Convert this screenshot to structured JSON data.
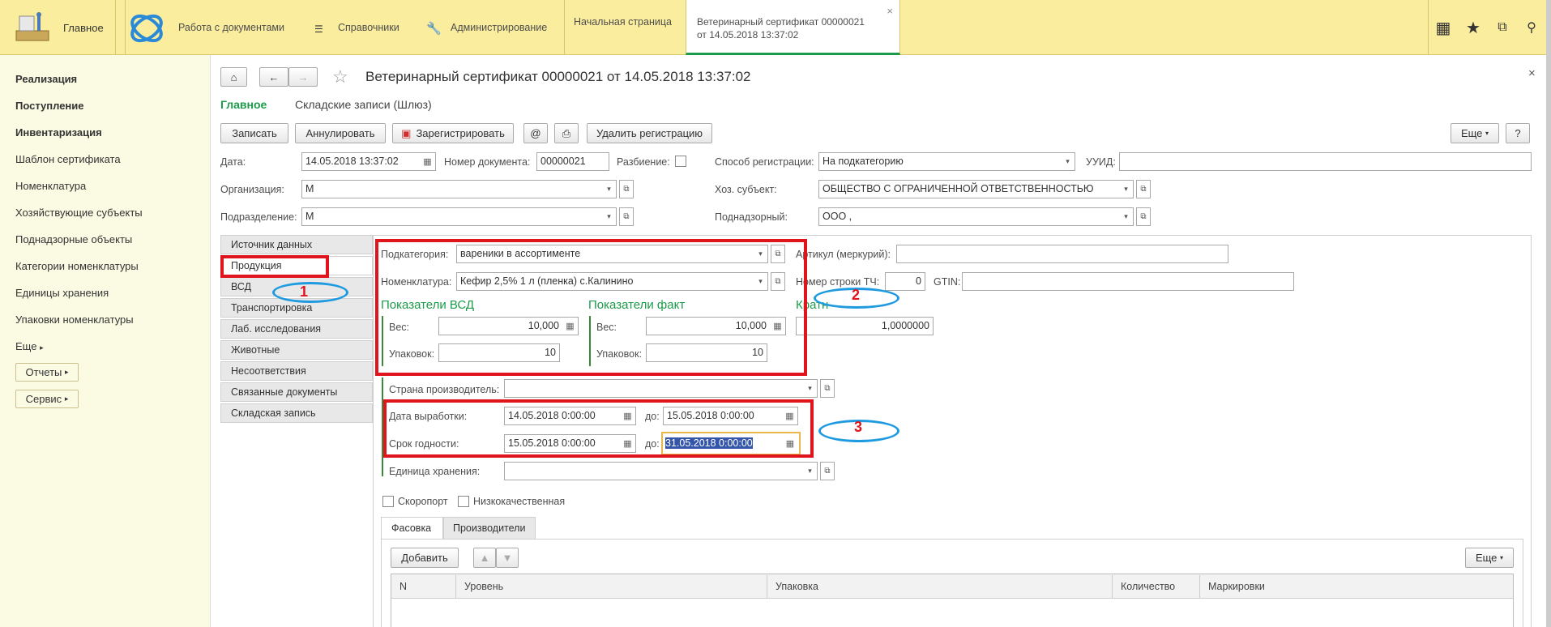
{
  "topbar": {
    "home_label": "Главное",
    "sections": [
      {
        "label": "Работа с документами"
      },
      {
        "label": "Справочники"
      },
      {
        "label": "Администрирование"
      }
    ],
    "tabs": [
      {
        "label": "Начальная страница"
      },
      {
        "label_line1": "Ветеринарный сертификат 00000021",
        "label_line2": "от 14.05.2018 13:37:02"
      }
    ],
    "close_glyph": "×"
  },
  "leftnav": {
    "items": [
      {
        "label": "Реализация",
        "bold": true
      },
      {
        "label": "Поступление",
        "bold": true
      },
      {
        "label": "Инвентаризация",
        "bold": true
      },
      {
        "label": "Шаблон сертификата"
      },
      {
        "label": "Номенклатура"
      },
      {
        "label": "Хозяйствующие субъекты"
      },
      {
        "label": "Поднадзорные объекты"
      },
      {
        "label": "Категории номенклатуры"
      },
      {
        "label": "Единицы хранения"
      },
      {
        "label": "Упаковки номенклатуры"
      },
      {
        "label": "Еще"
      }
    ],
    "buttons": [
      {
        "label": "Отчеты"
      },
      {
        "label": "Сервис"
      }
    ]
  },
  "form": {
    "title": "Ветеринарный сертификат 00000021 от 14.05.2018 13:37:02",
    "close_glyph": "×",
    "subnav": {
      "main": "Главное",
      "other": "Складские записи (Шлюз)"
    },
    "toolbar": {
      "save": "Записать",
      "cancel": "Аннулировать",
      "register": "Зарегистрировать",
      "at": "@",
      "delete_reg": "Удалить регистрацию",
      "more": "Еще",
      "help": "?"
    },
    "header": {
      "date_label": "Дата:",
      "date_value": "14.05.2018 13:37:02",
      "docnum_label": "Номер документа:",
      "docnum_value": "00000021",
      "split_label": "Разбиение:",
      "regmethod_label": "Способ регистрации:",
      "regmethod_value": "На подкатегорию",
      "uuid_label": "УУИД:",
      "uuid_value": "",
      "org_label": "Организация:",
      "org_value": "М",
      "subject_label": "Хоз. субъект:",
      "subject_value": "ОБЩЕСТВО С ОГРАНИЧЕННОЙ ОТВЕТСТВЕННОСТЬЮ",
      "dept_label": "Подразделение:",
      "dept_value": "М",
      "supervised_label": "Поднадзорный:",
      "supervised_value": "ООО   ,"
    },
    "sidetabs": [
      {
        "label": "Источник данных"
      },
      {
        "label": "Продукция"
      },
      {
        "label": "ВСД"
      },
      {
        "label": "Транспортировка"
      },
      {
        "label": "Лаб. исследования"
      },
      {
        "label": "Животные"
      },
      {
        "label": "Несоответствия"
      },
      {
        "label": "Связанные документы"
      },
      {
        "label": "Складская запись"
      }
    ],
    "product": {
      "subcat_label": "Подкатегория:",
      "subcat_value": "вареники в ассортименте",
      "nomen_label": "Номенклатура:",
      "nomen_value": "Кефир 2,5%  1 л (пленка) с.Калинино",
      "article_label": "Артикул (меркурий):",
      "article_value": "",
      "rownum_label": "Номер строки ТЧ:",
      "rownum_value": "0",
      "gtin_label": "GTIN:",
      "gtin_value": "",
      "vsd_heading": "Показатели ВСД",
      "fact_heading": "Показатели факт",
      "ratio_heading": "Кратн",
      "weight_label": "Вес:",
      "vsd_weight": "10,000",
      "fact_weight": "10,000",
      "packs_label": "Упаковок:",
      "vsd_packs": "10",
      "fact_packs": "10",
      "ratio_value": "1,0000000",
      "country_label": "Страна производитель:",
      "country_value": "",
      "prod_date_label": "Дата выработки:",
      "prod_date_from": "14.05.2018  0:00:00",
      "to_label": "до:",
      "prod_date_to": "15.05.2018  0:00:00",
      "expiry_label": "Срок годности:",
      "expiry_from": "15.05.2018  0:00:00",
      "expiry_to": "31.05.2018  0:00:00",
      "unit_label": "Единица хранения:",
      "unit_value": "",
      "perishable_label": "Скоропорт",
      "lowquality_label": "Низкокачественная"
    },
    "bottomtabs": [
      {
        "label": "Фасовка"
      },
      {
        "label": "Производители"
      }
    ],
    "table": {
      "add_label": "Добавить",
      "more_label": "Еще",
      "columns": [
        "N",
        "Уровень",
        "Упаковка",
        "Количество",
        "Маркировки"
      ]
    }
  },
  "annotations": {
    "one": "1",
    "two": "2",
    "three": "3"
  },
  "colors": {
    "topbar": "#fbed9e",
    "leftnav": "#fbfbe4",
    "accent_green": "#1c9a4a",
    "annotation_red": "#e0141c",
    "annotation_blue": "#1e9be0"
  }
}
